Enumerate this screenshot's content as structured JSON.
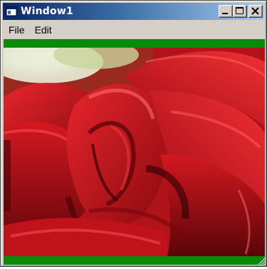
{
  "window": {
    "title": "Window1"
  },
  "menu": {
    "items": [
      {
        "label": "File"
      },
      {
        "label": "Edit"
      }
    ]
  },
  "colors": {
    "titlebar_start": "#0a246a",
    "titlebar_end": "#a6caf0",
    "frame": "#d4d0c8",
    "green_bar": "#0a8a0a",
    "rose_red": "#c0121a"
  },
  "icons": {
    "app": "window-app-icon",
    "minimize": "minimize-icon",
    "maximize": "maximize-icon",
    "close": "close-icon",
    "resize": "resize-grip-icon"
  }
}
